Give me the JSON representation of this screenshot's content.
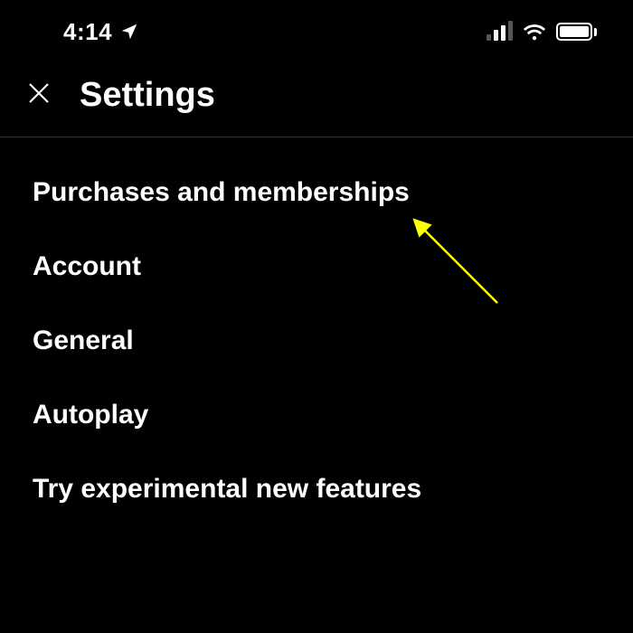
{
  "status_bar": {
    "time": "4:14"
  },
  "header": {
    "title": "Settings"
  },
  "settings": {
    "items": [
      {
        "label": "Purchases and memberships"
      },
      {
        "label": "Account"
      },
      {
        "label": "General"
      },
      {
        "label": "Autoplay"
      },
      {
        "label": "Try experimental new features"
      }
    ]
  }
}
